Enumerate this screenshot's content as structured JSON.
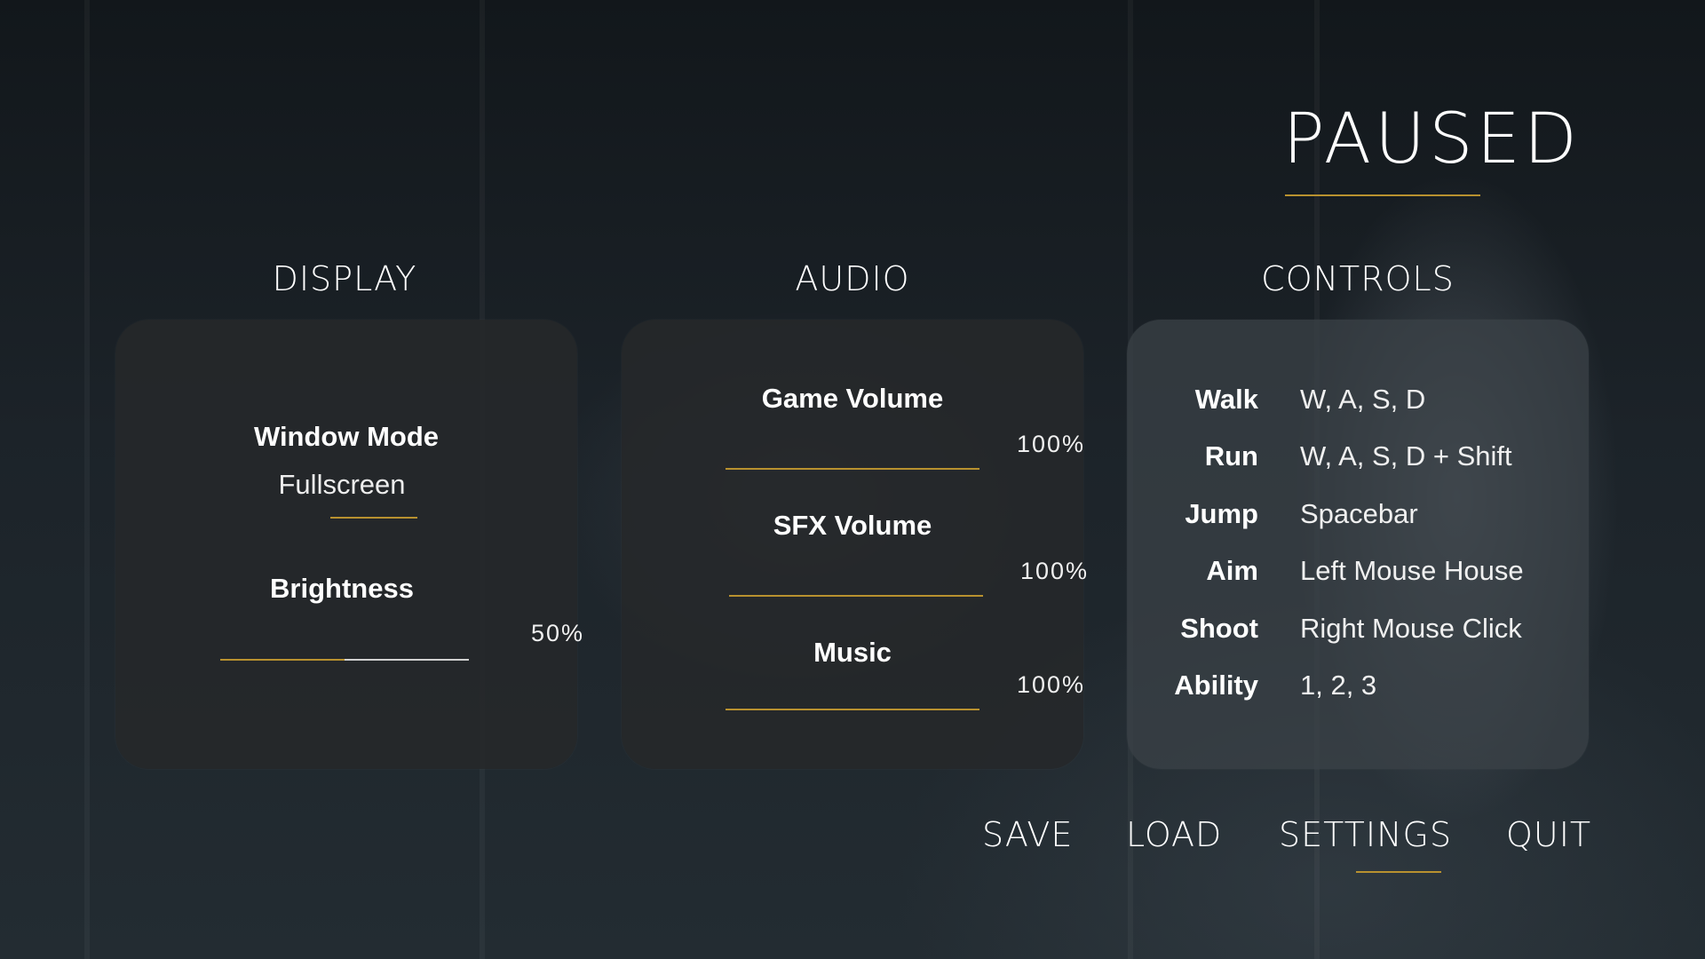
{
  "title": "PAUSED",
  "colors": {
    "accent": "#b8912f",
    "panel": "#26282a",
    "text": "#ffffff"
  },
  "display": {
    "heading": "DISPLAY",
    "window_mode_label": "Window Mode",
    "window_mode_value": "Fullscreen",
    "brightness_label": "Brightness",
    "brightness_value": "50%",
    "brightness_level": 0.5
  },
  "audio": {
    "heading": "AUDIO",
    "sliders": [
      {
        "label": "Game Volume",
        "value": "100%",
        "level": 1.0
      },
      {
        "label": "SFX Volume",
        "value": "100%",
        "level": 1.0
      },
      {
        "label": "Music",
        "value": "100%",
        "level": 1.0
      }
    ]
  },
  "controls": {
    "heading": "CONTROLS",
    "bindings": [
      {
        "action": "Walk",
        "keys": "W, A, S, D"
      },
      {
        "action": "Run",
        "keys": "W, A, S, D + Shift"
      },
      {
        "action": "Jump",
        "keys": "Spacebar"
      },
      {
        "action": "Aim",
        "keys": "Left Mouse House"
      },
      {
        "action": "Shoot",
        "keys": "Right Mouse Click"
      },
      {
        "action": "Ability",
        "keys": "1, 2, 3"
      }
    ]
  },
  "menu": {
    "items": [
      "SAVE",
      "LOAD",
      "SETTINGS",
      "QUIT"
    ],
    "active": "SETTINGS"
  }
}
